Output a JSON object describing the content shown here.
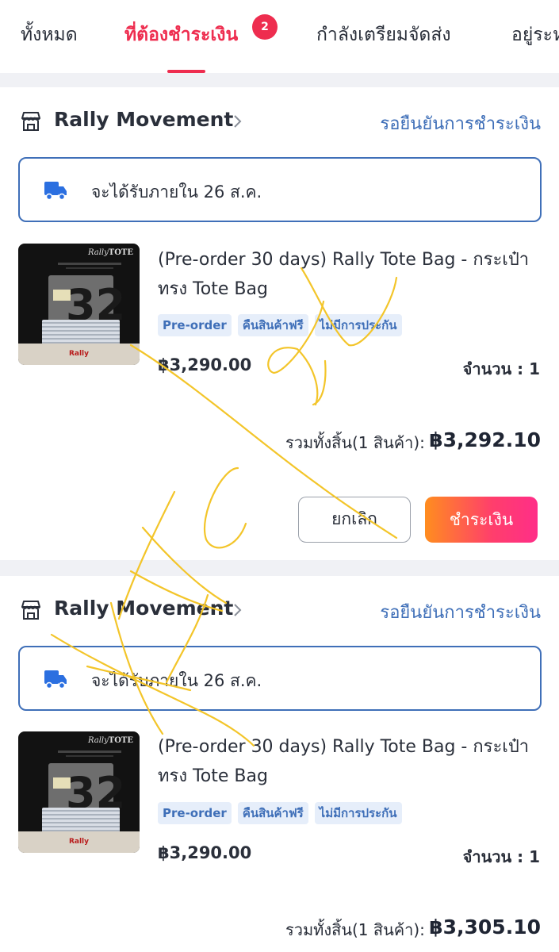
{
  "tabs": [
    {
      "label": "ทั้งหมด"
    },
    {
      "label": "ที่ต้องชำระเงิน",
      "badge": "2",
      "active": true
    },
    {
      "label": "กำลังเตรียมจัดส่ง"
    },
    {
      "label": "อยู่ระห"
    }
  ],
  "colors": {
    "accent": "#ee2d4f",
    "link_blue": "#3f6fb8",
    "pay_gradient": [
      "#ff8d1f",
      "#ff2e88"
    ],
    "scribble": "#f3c52a"
  },
  "orders": [
    {
      "store_name": "Rally Movement",
      "status": "รอยืนยันการชำระเงิน",
      "delivery": "จะได้รับภายใน 26 ส.ค.",
      "product": {
        "title": "(Pre-order 30 days) Rally Tote Bag - กระเป๋าทรง Tote Bag",
        "tags": [
          "Pre-order",
          "คืนสินค้าฟรี",
          "ไม่มีการประกัน"
        ],
        "price": "฿3,290.00",
        "quantity": "จำนวน : 1",
        "image_brand": "Rally",
        "image_brand_suffix": "TOTE",
        "image_label": "Rally"
      },
      "total_label": "รวมทั้งสิ้น(1 สินค้า):",
      "total_value": "฿3,292.10",
      "cancel_label": "ยกเลิก",
      "pay_label": "ชำระเงิน"
    },
    {
      "store_name": "Rally Movement",
      "status": "รอยืนยันการชำระเงิน",
      "delivery": "จะได้รับภายใน 26 ส.ค.",
      "product": {
        "title": "(Pre-order 30 days) Rally Tote Bag - กระเป๋าทรง Tote Bag",
        "tags": [
          "Pre-order",
          "คืนสินค้าฟรี",
          "ไม่มีการประกัน"
        ],
        "price": "฿3,290.00",
        "quantity": "จำนวน : 1",
        "image_brand": "Rally",
        "image_brand_suffix": "TOTE",
        "image_label": "Rally"
      },
      "total_label": "รวมทั้งสิ้น(1 สินค้า):",
      "total_value": "฿3,305.10"
    }
  ]
}
